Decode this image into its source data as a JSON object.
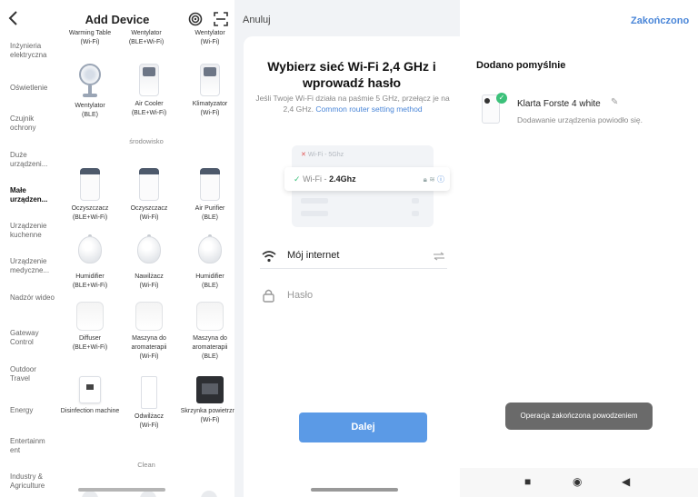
{
  "panel1": {
    "title": "Add Device",
    "categories": [
      "Inżynieria elektryczna",
      "Oświetlenie",
      "Czujnik ochrony",
      "Duże urządzeni...",
      "Małe urządzen...",
      "Urządzenie kuchenne",
      "Urządzenie medyczne...",
      "Nadzór wideo",
      "Gateway Control",
      "Outdoor Travel",
      "Energy",
      "Entertainm ent",
      "Industry & Agriculture"
    ],
    "top_partial_items": [
      {
        "name": "Warming Table",
        "conn": "(Wi-Fi)"
      },
      {
        "name": "Wentylator",
        "conn": "(BLE+Wi-Fi)"
      },
      {
        "name": "Wentylator",
        "conn": "(Wi-Fi)"
      }
    ],
    "row1": [
      {
        "name": "Wentylator",
        "conn": "(BLE)",
        "icon": "fan-icon"
      },
      {
        "name": "Air Cooler",
        "conn": "(BLE+Wi-Fi)",
        "icon": "air-cooler-icon"
      },
      {
        "name": "Klimatyzator",
        "conn": "(Wi-Fi)",
        "icon": "air-conditioner-icon"
      }
    ],
    "section_env": "środowisko",
    "row2": [
      {
        "name": "Oczyszczacz",
        "conn": "(BLE+Wi-Fi)",
        "icon": "air-purifier-icon"
      },
      {
        "name": "Oczyszczacz",
        "conn": "(Wi-Fi)",
        "icon": "air-purifier-icon"
      },
      {
        "name": "Air Purifier",
        "conn": "(BLE)",
        "icon": "air-purifier-icon"
      }
    ],
    "row3": [
      {
        "name": "Humidifier",
        "conn": "(BLE+Wi-Fi)",
        "icon": "humidifier-icon"
      },
      {
        "name": "Nawilżacz",
        "conn": "(Wi-Fi)",
        "icon": "humidifier-icon"
      },
      {
        "name": "Humidifier",
        "conn": "(BLE)",
        "icon": "humidifier-icon"
      }
    ],
    "row4": [
      {
        "name": "Diffuser",
        "conn": "(BLE+Wi-Fi)",
        "icon": "diffuser-icon"
      },
      {
        "name": "Maszyna do aromaterapii",
        "conn": "(Wi-Fi)",
        "icon": "diffuser-icon"
      },
      {
        "name": "Maszyna do aromaterapii",
        "conn": "(BLE)",
        "icon": "diffuser-icon"
      }
    ],
    "row5": [
      {
        "name": "Disinfection machine",
        "conn": "",
        "icon": "disinfection-machine-icon"
      },
      {
        "name": "Odwilżacz",
        "conn": "(Wi-Fi)",
        "icon": "dehumidifier-icon"
      },
      {
        "name": "Skrzynka powietrzna",
        "conn": "(Wi-Fi)",
        "icon": "air-box-icon"
      }
    ],
    "section_clean": "Clean"
  },
  "panel2": {
    "cancel": "Anuluj",
    "heading": "Wybierz sieć Wi-Fi 2,4 GHz i wprowadź hasło",
    "subtitle": "Jeśli Twoje Wi-Fi działa na paśmie 5 GHz, przełącz je na 2,4 GHz.",
    "subtitle_link": "Common router setting method",
    "illus_5g_prefix": "Wi-Fi - ",
    "illus_5g_band": "5Ghz",
    "illus_24_prefix": "Wi-Fi - ",
    "illus_24_band": "2.4Ghz",
    "wifi_name": "Mój internet",
    "password_placeholder": "Hasło",
    "next_button": "Dalej"
  },
  "panel3": {
    "done": "Zakończono",
    "heading": "Dodano pomyślnie",
    "device_name": "Klarta Forste 4 white",
    "device_msg": "Dodawanie urządzenia powiodło się.",
    "toast": "Operacja zakończona powodzeniem"
  },
  "colors": {
    "accent": "#4a86d8",
    "button": "#5b9ae6",
    "success": "#3cc17a"
  }
}
